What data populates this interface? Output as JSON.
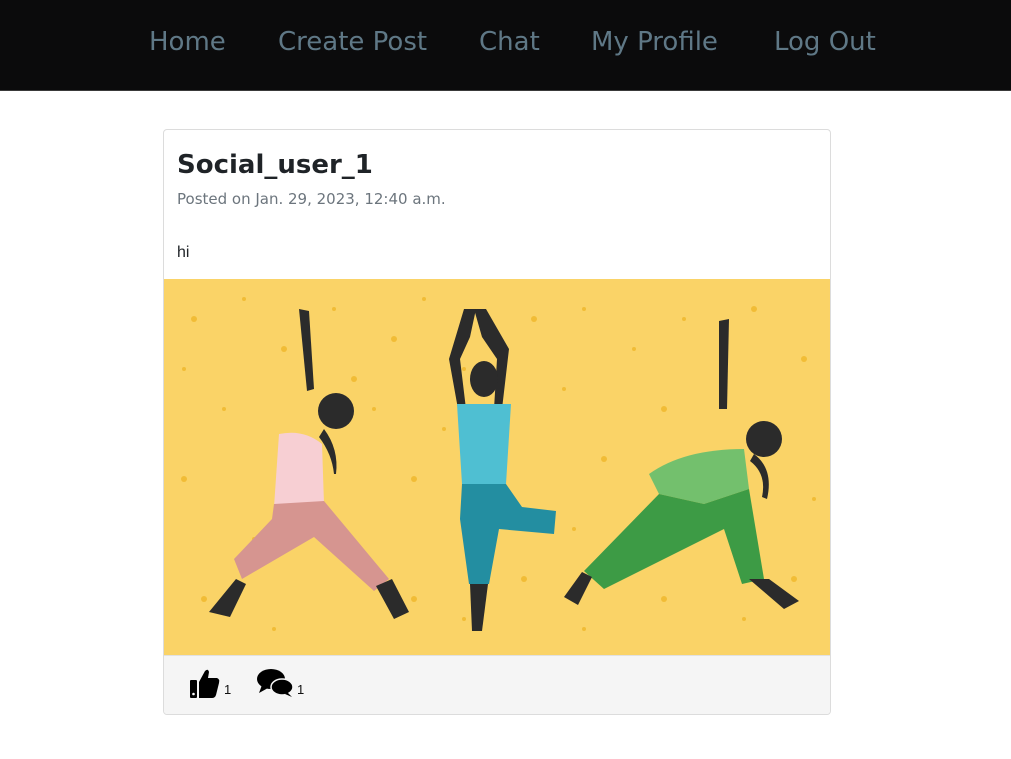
{
  "nav": {
    "items": [
      {
        "label": "Home"
      },
      {
        "label": "Create Post"
      },
      {
        "label": "Chat"
      },
      {
        "label": "My Profile"
      },
      {
        "label": "Log Out"
      }
    ]
  },
  "post": {
    "author": "Social_user_1",
    "posted_on": "Posted on Jan. 29, 2023, 12:40 a.m.",
    "body": "hi",
    "image_icon": "yoga-illustration",
    "like_icon": "thumbs-up-icon",
    "comment_icon": "comments-icon",
    "like_count": "1",
    "comment_count": "1"
  },
  "colors": {
    "navbar_bg": "#0b0b0c",
    "nav_text": "#5f7886",
    "image_bg": "#fad367",
    "footer_bg": "#f5f5f5"
  }
}
